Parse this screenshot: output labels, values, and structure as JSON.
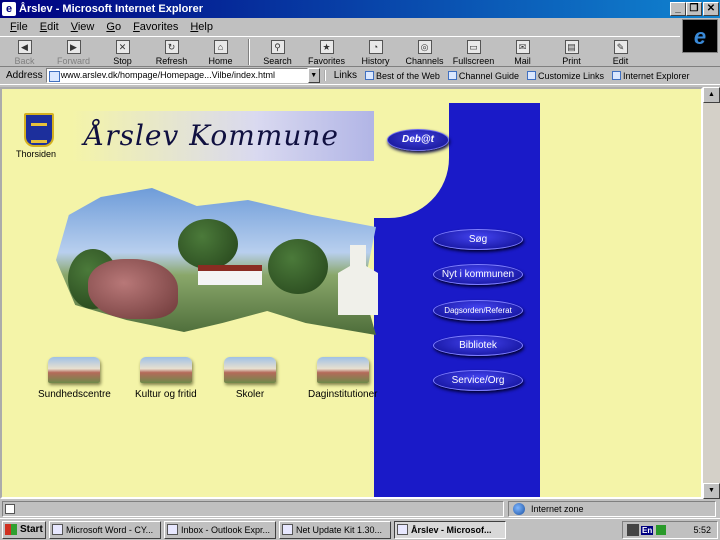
{
  "window": {
    "title": "Årslev - Microsoft Internet Explorer",
    "controls": [
      "_",
      "❐",
      "✕"
    ]
  },
  "menu": [
    "File",
    "Edit",
    "View",
    "Go",
    "Favorites",
    "Help"
  ],
  "toolbar": {
    "buttons": [
      {
        "label": "Back",
        "icon": "back-arrow-icon",
        "disabled": true
      },
      {
        "label": "Forward",
        "icon": "forward-arrow-icon",
        "disabled": true
      },
      {
        "label": "Stop",
        "icon": "stop-icon",
        "disabled": false
      },
      {
        "label": "Refresh",
        "icon": "refresh-icon",
        "disabled": false
      },
      {
        "label": "Home",
        "icon": "home-icon",
        "disabled": false
      },
      {
        "label": "Search",
        "icon": "search-icon",
        "disabled": false
      },
      {
        "label": "Favorites",
        "icon": "favorites-icon",
        "disabled": false
      },
      {
        "label": "History",
        "icon": "history-icon",
        "disabled": false
      },
      {
        "label": "Channels",
        "icon": "channels-icon",
        "disabled": false
      },
      {
        "label": "Fullscreen",
        "icon": "fullscreen-icon",
        "disabled": false
      },
      {
        "label": "Mail",
        "icon": "mail-icon",
        "disabled": false
      },
      {
        "label": "Print",
        "icon": "print-icon",
        "disabled": false
      },
      {
        "label": "Edit",
        "icon": "edit-icon",
        "disabled": false
      }
    ]
  },
  "address": {
    "label": "Address",
    "value": "www.arslev.dk/hompage/Homepage...Vilbe/index.html",
    "links_label": "Links",
    "links": [
      "Best of the Web",
      "Channel Guide",
      "Customize Links",
      "Internet Explorer"
    ]
  },
  "page": {
    "frontpage_link": "Thorsiden",
    "title": "Årslev Kommune",
    "debat": "Deb@t",
    "nav": [
      "Søg",
      "Nyt i kommunen",
      "Dagsorden/Referat",
      "Bibliotek",
      "Service/Org"
    ],
    "facilities": [
      "Sundhedscentre",
      "Kultur og fritid",
      "Skoler",
      "Daginstitutioner"
    ]
  },
  "status": {
    "zone": "Internet zone"
  },
  "taskbar": {
    "start": "Start",
    "tasks": [
      {
        "label": "Microsoft Word - CY..."
      },
      {
        "label": "Inbox - Outlook Expr..."
      },
      {
        "label": "Net Update Kit 1.30..."
      },
      {
        "label": "Årslev - Microsof...",
        "active": true
      }
    ],
    "tray_lang": "En",
    "clock": "5:52"
  },
  "colors": {
    "page_bg": "#f4f4a8",
    "nav_blue": "#1a1ac8",
    "title_bar": "#000080"
  }
}
